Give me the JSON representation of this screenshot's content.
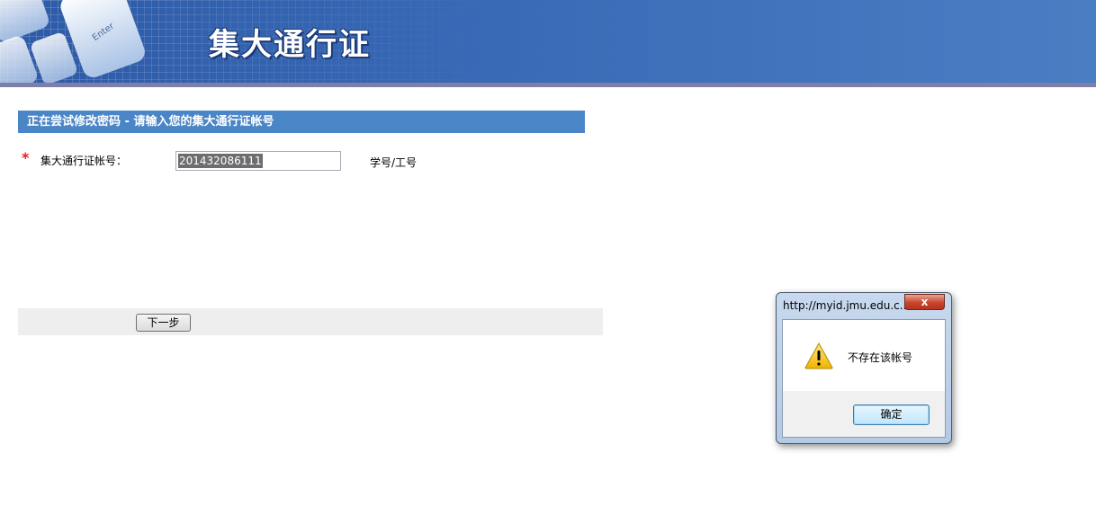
{
  "header": {
    "title": "集大通行证",
    "keyboard_key_label": "Enter"
  },
  "form": {
    "section_title": "正在尝试修改密码 - 请输入您的集大通行证帐号",
    "required_mark": "*",
    "account_label": "集大通行证帐号：",
    "account_value": "201432086111",
    "account_hint": "学号/工号",
    "next_button": "下一步"
  },
  "dialog": {
    "title": "http://myid.jmu.edu.c...",
    "close_label": "x",
    "icon": "warning-icon",
    "message": "不存在该帐号",
    "ok_button": "确定"
  },
  "colors": {
    "banner": "#3768b5",
    "section_header": "#4a86c7",
    "required": "#e02020"
  }
}
